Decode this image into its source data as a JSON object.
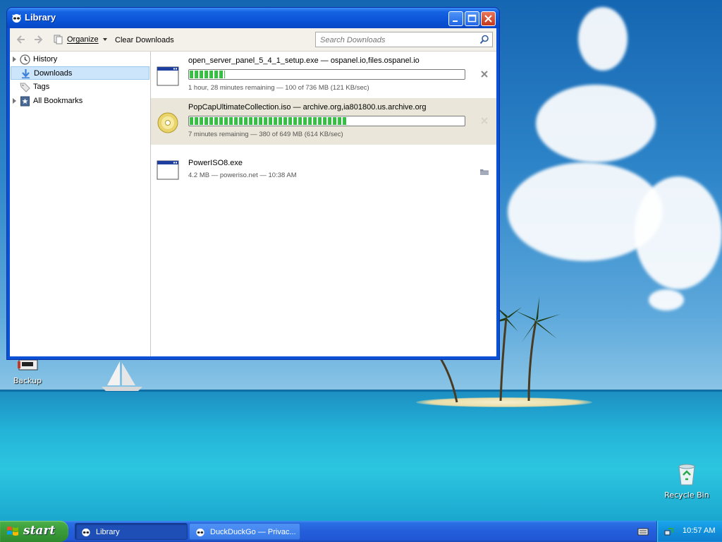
{
  "window": {
    "title": "Library",
    "toolbar": {
      "organize_label": "Organize",
      "clear_label": "Clear Downloads",
      "search_placeholder": "Search Downloads"
    },
    "sidebar": {
      "items": [
        {
          "label": "History",
          "icon": "history-icon",
          "expandable": true
        },
        {
          "label": "Downloads",
          "icon": "downloads-icon",
          "expandable": false,
          "selected": true
        },
        {
          "label": "Tags",
          "icon": "tags-icon",
          "expandable": false
        },
        {
          "label": "All Bookmarks",
          "icon": "bookmarks-icon",
          "expandable": true
        }
      ]
    },
    "downloads": [
      {
        "name": "open_server_panel_5_4_1_setup.exe — ospanel.io,files.ospanel.io",
        "status": "1 hour, 28 minutes remaining — 100 of 736 MB (121 KB/sec)",
        "progress": 0.13,
        "icon": "exe-file-icon",
        "action": "cancel"
      },
      {
        "name": "PopCapUltimateCollection.iso — archive.org,ia801800.us.archive.org",
        "status": "7 minutes remaining — 380 of 649 MB (614 KB/sec)",
        "progress": 0.58,
        "icon": "disc-image-icon",
        "action": "cancel"
      },
      {
        "name": "PowerISO8.exe",
        "status": "4.2 MB — poweriso.net — 10:38 AM",
        "progress": null,
        "icon": "exe-file-icon",
        "action": "open-folder"
      }
    ]
  },
  "desktop": {
    "icons": [
      {
        "label": "Backup"
      },
      {
        "label": "Recycle Bin"
      }
    ]
  },
  "taskbar": {
    "start_label": "start",
    "tasks": [
      {
        "label": "Library",
        "active": true
      },
      {
        "label": "DuckDuckGo — Privac...",
        "active": false
      }
    ],
    "clock": "10:57 AM"
  },
  "colors": {
    "titlebar": "#0a55d8",
    "progress_fill": "#3fc94b",
    "selected_row": "#eae6d9",
    "sidebar_selected": "#cce5fb",
    "start_button": "#3d9e3b",
    "tray": "#118fdb"
  }
}
